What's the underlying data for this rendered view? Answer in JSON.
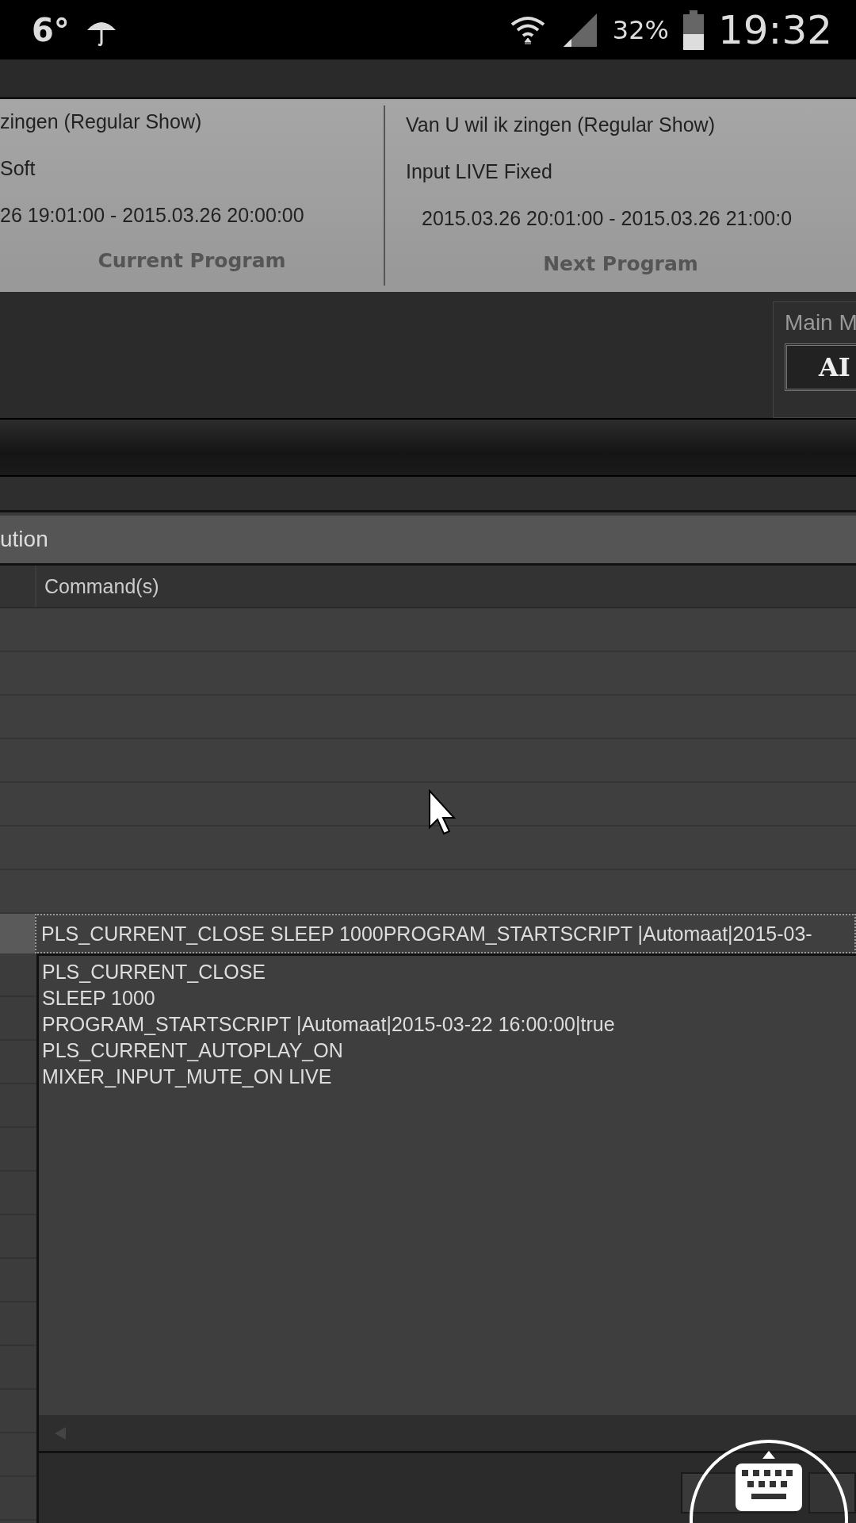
{
  "status_bar": {
    "temperature": "6°",
    "battery": "32%",
    "time": "19:32"
  },
  "current_program": {
    "title": "zingen (Regular Show)",
    "source": "Soft",
    "period": "26 19:01:00 - 2015.03.26 20:00:00",
    "label": "Current Program"
  },
  "next_program": {
    "title": "Van U wil ik zingen (Regular Show)",
    "source": "Input LIVE Fixed",
    "period": "2015.03.26 20:01:00 - 2015.03.26 21:00:0",
    "label": "Next Program"
  },
  "main_panel": {
    "title": "Main M",
    "button": "AI"
  },
  "section": {
    "title": "ution"
  },
  "table": {
    "columns": [
      "Command(s)"
    ],
    "selected_row": "PLS_CURRENT_CLOSE SLEEP 1000PROGRAM_STARTSCRIPT |Automaat|2015-03-"
  },
  "editor": {
    "lines": [
      "PLS_CURRENT_CLOSE",
      "SLEEP 1000",
      "PROGRAM_STARTSCRIPT |Automaat|2015-03-22 16:00:00|true",
      "PLS_CURRENT_AUTOPLAY_ON",
      "MIXER_INPUT_MUTE_ON LIVE"
    ]
  }
}
